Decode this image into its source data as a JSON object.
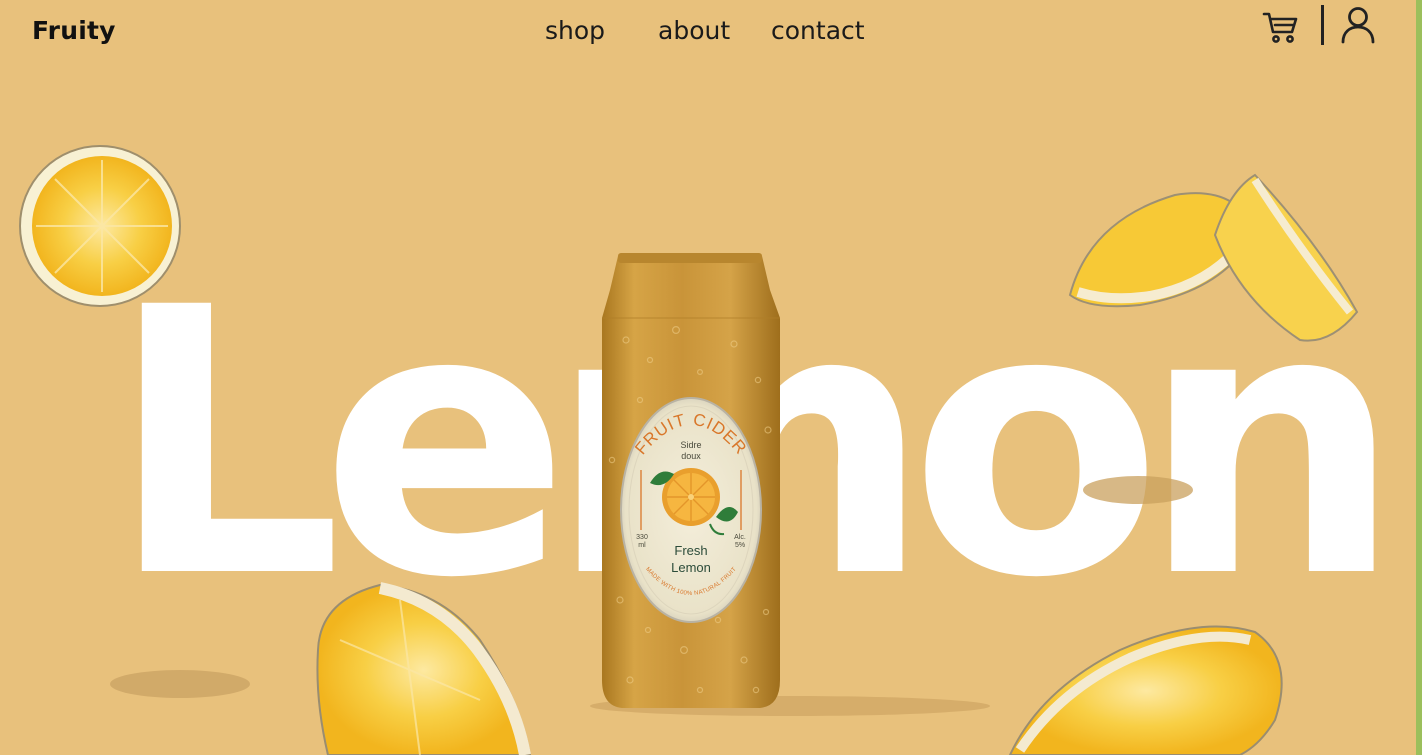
{
  "brand": {
    "logo": "Fruity"
  },
  "nav": {
    "links": [
      {
        "label": "shop"
      },
      {
        "label": "about"
      },
      {
        "label": "contact"
      }
    ]
  },
  "header_actions": {
    "cart_icon": "cart-icon",
    "user_icon": "user-icon"
  },
  "hero": {
    "word": "Lemon",
    "product": {
      "label_title": "FRUIT CIDER",
      "label_sub_1": "Sidre",
      "label_sub_2": "doux",
      "volume_1": "330",
      "volume_2": "ml",
      "alc_1": "Alc.",
      "alc_2": "5%",
      "flavor_1": "Fresh",
      "flavor_2": "Lemon",
      "tagline": "MADE WITH 100% NATURAL FRUIT"
    }
  },
  "colors": {
    "background": "#e8c17c",
    "hero_text": "#ffffff",
    "can": "#c89532",
    "label_accent": "#d9772a"
  }
}
